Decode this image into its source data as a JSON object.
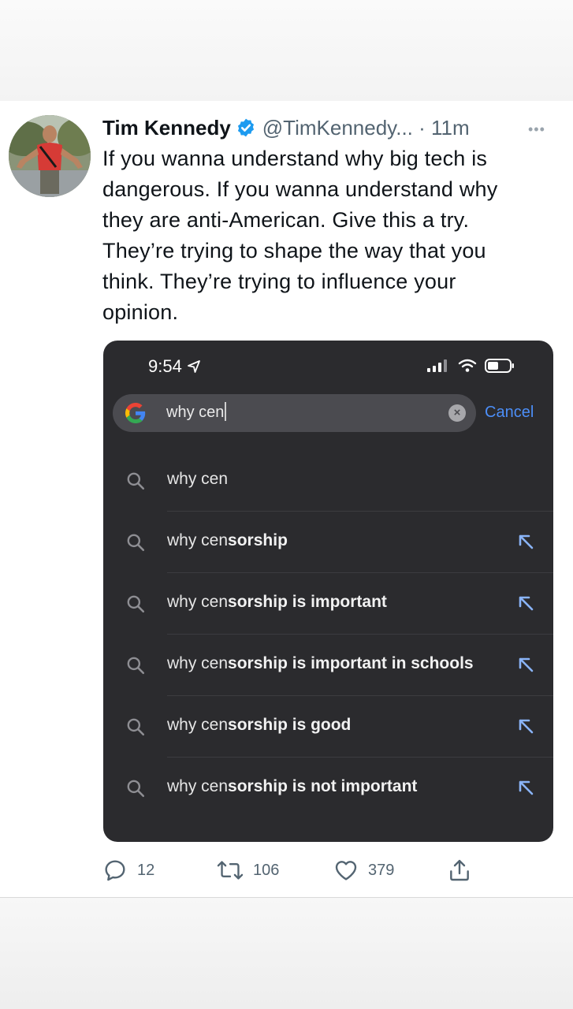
{
  "tweet": {
    "author_name": "Tim Kennedy",
    "handle_time": "@TimKennedy... · 11m",
    "more": "•••",
    "text": "If you wanna understand why big tech is\ndangerous. If you wanna understand why\nthey are anti-American. Give this a try.\nThey’re trying to shape the way that you\nthink. They’re trying to influence your\nopinion."
  },
  "phone": {
    "time": "9:54",
    "search_value": "why cen",
    "cancel_label": "Cancel",
    "clear_icon": "×",
    "suggestions": [
      {
        "typed": "why cen",
        "rest": "",
        "has_arrow": false
      },
      {
        "typed": "why cen",
        "rest": "sorship",
        "has_arrow": true
      },
      {
        "typed": "why cen",
        "rest": "sorship is important",
        "has_arrow": true
      },
      {
        "typed": "why cen",
        "rest": "sorship is important in schools",
        "has_arrow": true
      },
      {
        "typed": "why cen",
        "rest": "sorship is good",
        "has_arrow": true
      },
      {
        "typed": "why cen",
        "rest": "sorship is not important",
        "has_arrow": true
      }
    ]
  },
  "actions": {
    "replies": "12",
    "retweets": "106",
    "likes": "379"
  },
  "icons": {
    "verified": "verified-badge-icon",
    "location": "location-arrow-icon",
    "signal": "cellular-signal-icon",
    "wifi": "wifi-icon",
    "battery": "battery-icon",
    "google": "google-logo-icon",
    "search": "search-icon",
    "fill": "arrow-up-left-icon",
    "reply": "reply-icon",
    "retweet": "retweet-icon",
    "like": "heart-icon",
    "share": "share-icon"
  },
  "colors": {
    "verified": "#1d9bf0",
    "text": "#0f1419",
    "muted": "#536471",
    "phone_bg": "#2b2b2e",
    "cancel": "#4c8ef7"
  }
}
